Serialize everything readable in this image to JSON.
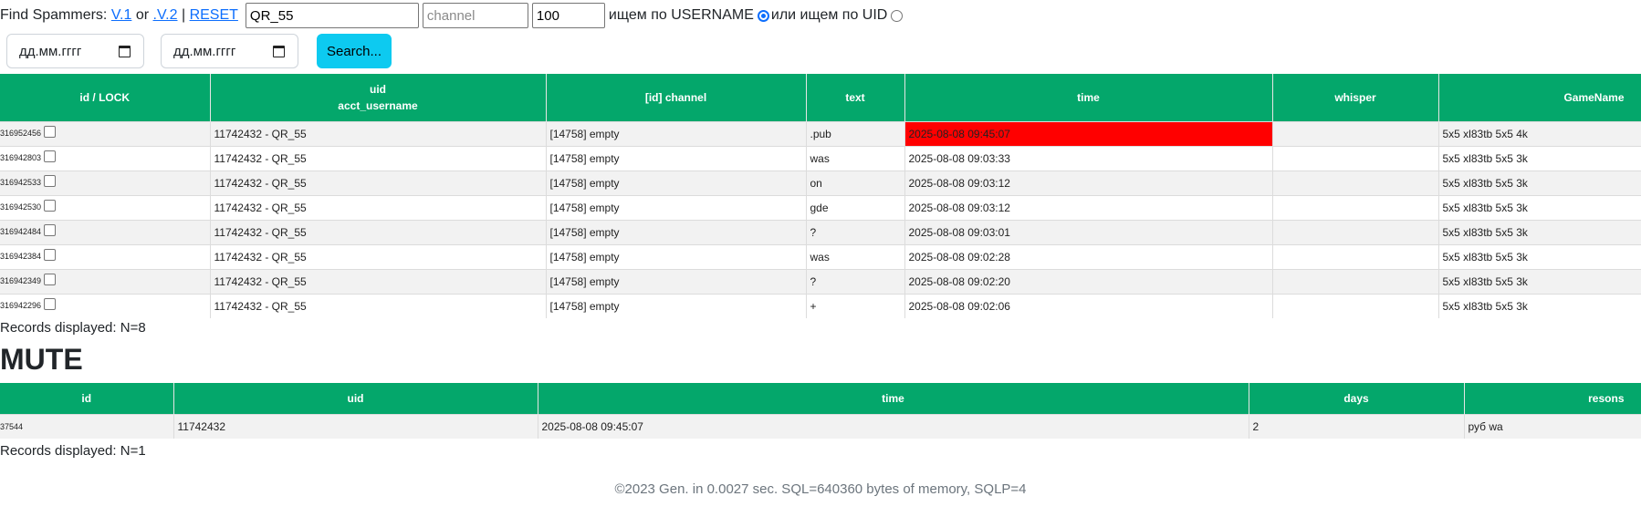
{
  "search": {
    "label": "Find Spammers:",
    "link_v1": "V.1",
    "or_text": "or",
    "link_v2": ".V.2",
    "separator": "|",
    "link_reset": "RESET",
    "username_value": "QR_55",
    "channel_placeholder": "channel",
    "limit_value": "100",
    "radio_username_label": "ищем по USERNAME",
    "radio_uid_label": "или ищем по UID",
    "date_from_placeholder": "дд.мм.гггг",
    "date_to_placeholder": "дд.мм.гггг",
    "search_button": "Search..."
  },
  "messages": {
    "headers": [
      "id / LOCK",
      "uid",
      "acct_username",
      "[id] channel",
      "text",
      "time",
      "whisper",
      "GameName"
    ],
    "rows": [
      {
        "id": "316952456",
        "uid": "11742432 - QR_55",
        "channel": "[14758] empty",
        "text": ".pub",
        "time": "2025-08-08 09:45:07",
        "whisper": "",
        "game": "5x5 xl83tb 5x5 4k"
      },
      {
        "id": "316942803",
        "uid": "11742432 - QR_55",
        "channel": "[14758] empty",
        "text": "was",
        "time": "2025-08-08 09:03:33",
        "whisper": "",
        "game": "5x5 xl83tb 5x5 3k"
      },
      {
        "id": "316942533",
        "uid": "11742432 - QR_55",
        "channel": "[14758] empty",
        "text": "on",
        "time": "2025-08-08 09:03:12",
        "whisper": "",
        "game": "5x5 xl83tb 5x5 3k"
      },
      {
        "id": "316942530",
        "uid": "11742432 - QR_55",
        "channel": "[14758] empty",
        "text": "gde",
        "time": "2025-08-08 09:03:12",
        "whisper": "",
        "game": "5x5 xl83tb 5x5 3k"
      },
      {
        "id": "316942484",
        "uid": "11742432 - QR_55",
        "channel": "[14758] empty",
        "text": "?",
        "time": "2025-08-08 09:03:01",
        "whisper": "",
        "game": "5x5 xl83tb 5x5 3k"
      },
      {
        "id": "316942384",
        "uid": "11742432 - QR_55",
        "channel": "[14758] empty",
        "text": "was",
        "time": "2025-08-08 09:02:28",
        "whisper": "",
        "game": "5x5 xl83tb 5x5 3k"
      },
      {
        "id": "316942349",
        "uid": "11742432 - QR_55",
        "channel": "[14758] empty",
        "text": "?",
        "time": "2025-08-08 09:02:20",
        "whisper": "",
        "game": "5x5 xl83tb 5x5 3k"
      },
      {
        "id": "316942296",
        "uid": "11742432 - QR_55",
        "channel": "[14758] empty",
        "text": "+",
        "time": "2025-08-08 09:02:06",
        "whisper": "",
        "game": "5x5 xl83tb 5x5 3k"
      }
    ],
    "records": "Records displayed: N=8"
  },
  "mute": {
    "title": "MUTE",
    "headers": [
      "id",
      "uid",
      "time",
      "days",
      "resons"
    ],
    "rows": [
      {
        "id": "37544",
        "uid": "11742432",
        "time": "2025-08-08 09:45:07",
        "days": "2",
        "reason": "руб wa"
      }
    ],
    "records": "Records displayed: N=1"
  },
  "footer": "©2023 Gen. in 0.0027 sec. SQL=640360 bytes of memory, SQLP=4",
  "colors": {
    "header_bg": "#04a76b",
    "highlight": "#ff0000",
    "button": "#0dcaf0"
  }
}
